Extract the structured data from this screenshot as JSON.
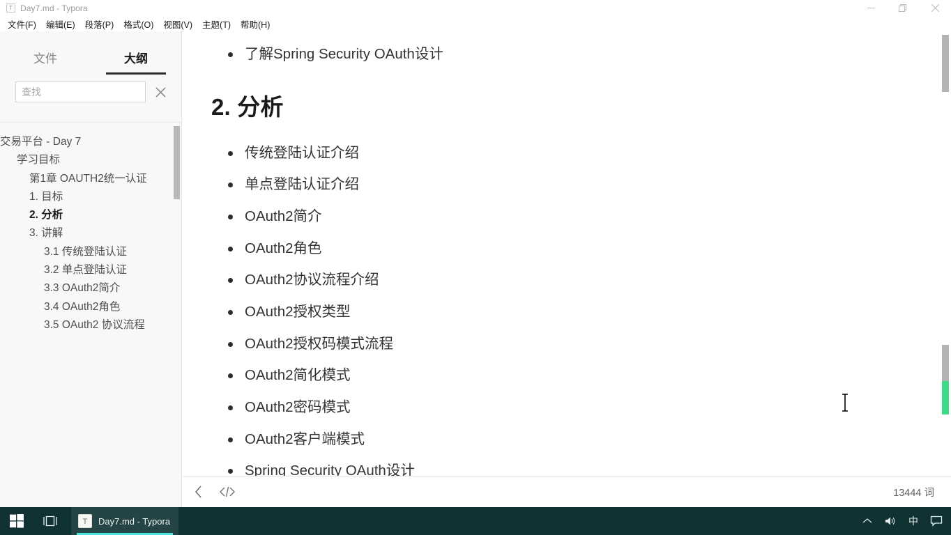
{
  "window": {
    "title": "Day7.md - Typora",
    "app_icon": "typora-icon",
    "controls": {
      "minimize": "minimize-icon",
      "maximize": "restore-icon",
      "close": "close-icon"
    }
  },
  "menubar": {
    "items": [
      {
        "label": "文件(F)",
        "mnemonic": "F"
      },
      {
        "label": "编辑(E)",
        "mnemonic": "E"
      },
      {
        "label": "段落(P)",
        "mnemonic": "P"
      },
      {
        "label": "格式(O)",
        "mnemonic": "O"
      },
      {
        "label": "视图(V)",
        "mnemonic": "V"
      },
      {
        "label": "主题(T)",
        "mnemonic": "T"
      },
      {
        "label": "帮助(H)",
        "mnemonic": "H"
      }
    ]
  },
  "sidebar": {
    "tabs": [
      {
        "label": "文件",
        "active": false
      },
      {
        "label": "大纲",
        "active": true
      }
    ],
    "search": {
      "placeholder": "查找",
      "value": "",
      "clear_icon": "close-icon"
    },
    "outline": [
      {
        "label": "交易平台 - Day 7",
        "level": 0,
        "active": false
      },
      {
        "label": "学习目标",
        "level": 1,
        "active": false
      },
      {
        "label": "第1章 OAUTH2统一认证",
        "level": 2,
        "active": false
      },
      {
        "label": "1. 目标",
        "level": 2,
        "active": false
      },
      {
        "label": "2. 分析",
        "level": 2,
        "active": true
      },
      {
        "label": "3. 讲解",
        "level": 2,
        "active": false
      },
      {
        "label": "3.1 传统登陆认证",
        "level": 3,
        "active": false
      },
      {
        "label": "3.2 单点登陆认证",
        "level": 3,
        "active": false
      },
      {
        "label": "3.3 OAuth2简介",
        "level": 3,
        "active": false
      },
      {
        "label": "3.4 OAuth2角色",
        "level": 3,
        "active": false
      },
      {
        "label": "3.5 OAuth2 协议流程",
        "level": 3,
        "active": false
      }
    ]
  },
  "editor": {
    "blocks": [
      {
        "type": "li",
        "text": "了解Spring Security OAuth设计"
      },
      {
        "type": "h2",
        "text": "2. 分析"
      },
      {
        "type": "li",
        "text": "传统登陆认证介绍"
      },
      {
        "type": "li",
        "text": "单点登陆认证介绍"
      },
      {
        "type": "li",
        "text": "OAuth2简介"
      },
      {
        "type": "li",
        "text": "OAuth2角色"
      },
      {
        "type": "li",
        "text": "OAuth2协议流程介绍"
      },
      {
        "type": "li",
        "text": "OAuth2授权类型"
      },
      {
        "type": "li",
        "text": "OAuth2授权码模式流程"
      },
      {
        "type": "li",
        "text": "OAuth2简化模式"
      },
      {
        "type": "li",
        "text": "OAuth2密码模式"
      },
      {
        "type": "li",
        "text": "OAuth2客户端模式"
      },
      {
        "type": "li",
        "text": "Spring Security OAuth设计"
      }
    ]
  },
  "statusbar": {
    "back_icon": "chevron-left-icon",
    "source_code_icon": "source-code-icon",
    "word_count": "13444 词"
  },
  "taskbar": {
    "start_icon": "windows-start-icon",
    "taskview_icon": "task-view-icon",
    "app": {
      "icon": "typora-icon",
      "label": "Day7.md - Typora"
    },
    "tray": [
      {
        "icon": "chevron-up-icon",
        "label": ""
      },
      {
        "icon": "speaker-icon",
        "label": ""
      },
      {
        "icon": "ime-lang-icon",
        "label": "中"
      },
      {
        "icon": "notification-icon",
        "label": ""
      }
    ]
  },
  "colors": {
    "sidebar_bg": "#f7f8f7",
    "taskbar_bg": "#103233",
    "taskbar_accent": "#4fe3e0",
    "scroll_green": "#3ddc84",
    "tab_underline": "#2b2b2b"
  }
}
